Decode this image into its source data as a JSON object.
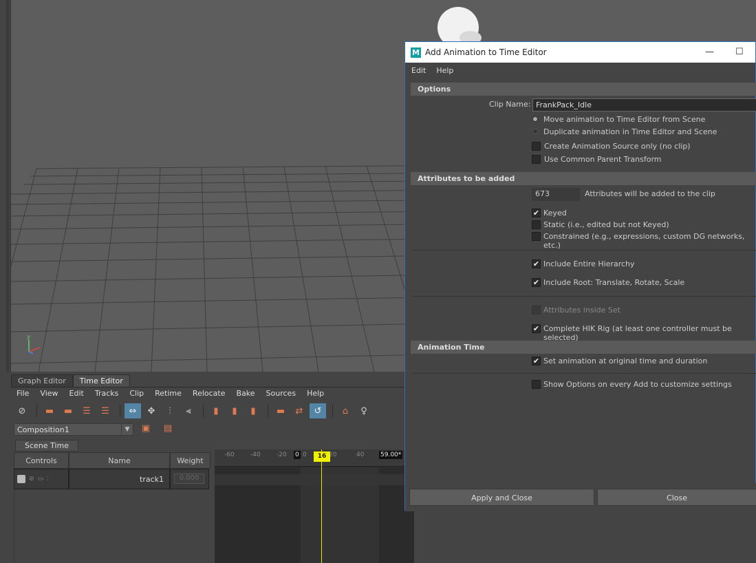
{
  "viewport": {
    "axis_y": "y"
  },
  "editor_tabs": [
    "Graph Editor",
    "Time Editor"
  ],
  "time_editor": {
    "menu": [
      "File",
      "View",
      "Edit",
      "Tracks",
      "Clip",
      "Retime",
      "Relocate",
      "Bake",
      "Sources",
      "Help"
    ],
    "composition": "Composition1",
    "scene_tab": "Scene Time",
    "columns": [
      "Controls",
      "Name",
      "Weight"
    ],
    "track": {
      "name": "track1",
      "weight": "0.000"
    },
    "ruler": {
      "ticks": [
        "-60",
        "-40",
        "-20",
        "0",
        "20",
        "40"
      ],
      "start": "0",
      "end": "59.00*",
      "playhead": "16"
    }
  },
  "dialog": {
    "title": "Add Animation to Time Editor",
    "menu": [
      "Edit",
      "Help"
    ],
    "sections": {
      "options": "Options",
      "attributes": "Attributes to be added",
      "animation_time": "Animation Time"
    },
    "clip_name_label": "Clip Name:",
    "clip_name_value": "FrankPack_Idle",
    "radio_move": "Move animation to Time Editor from Scene",
    "radio_duplicate": "Duplicate animation in Time Editor and Scene",
    "cb_source_only": "Create Animation Source only (no clip)",
    "cb_common_parent": "Use Common Parent Transform",
    "attr_count": "673",
    "attr_count_label": "Attributes will be added to the clip",
    "cb_keyed": "Keyed",
    "cb_static": "Static (i.e., edited but not Keyed)",
    "cb_constrained": "Constrained (e.g., expressions, custom DG networks, etc.)",
    "cb_hierarchy": "Include Entire Hierarchy",
    "cb_root": "Include Root: Translate, Rotate, Scale",
    "cb_inside_set": "Attributes inside Set",
    "cb_hik": "Complete HIK Rig (at least one controller must be selected)",
    "cb_original_time": "Set animation at original time and duration",
    "cb_show_options": "Show Options on every Add to customize settings",
    "apply_close": "Apply and Close",
    "close": "Close",
    "logo": "M"
  }
}
